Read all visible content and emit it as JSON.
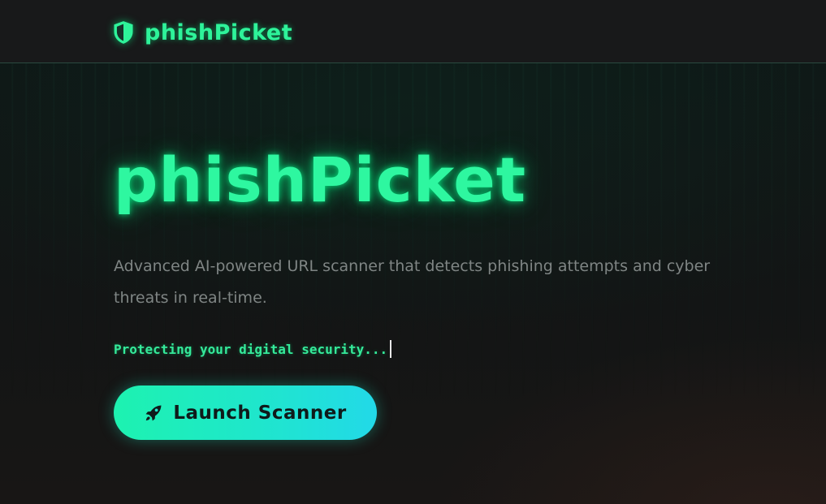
{
  "navbar": {
    "brand_icon": "shield-icon",
    "brand_name": "phishPicket"
  },
  "hero": {
    "title": "phishPicket",
    "description": "Advanced AI-powered URL scanner that detects phishing attempts and cyber threats in real-time.",
    "typing_text": "Protecting your digital security...",
    "launch_button": {
      "icon": "rocket-icon",
      "label": "Launch Scanner"
    }
  },
  "colors": {
    "accent_green": "#2ef7a0",
    "button_gradient_start": "#1df2b0",
    "button_gradient_end": "#22d9e8",
    "background": "#141515",
    "muted_text": "#7f8584"
  }
}
